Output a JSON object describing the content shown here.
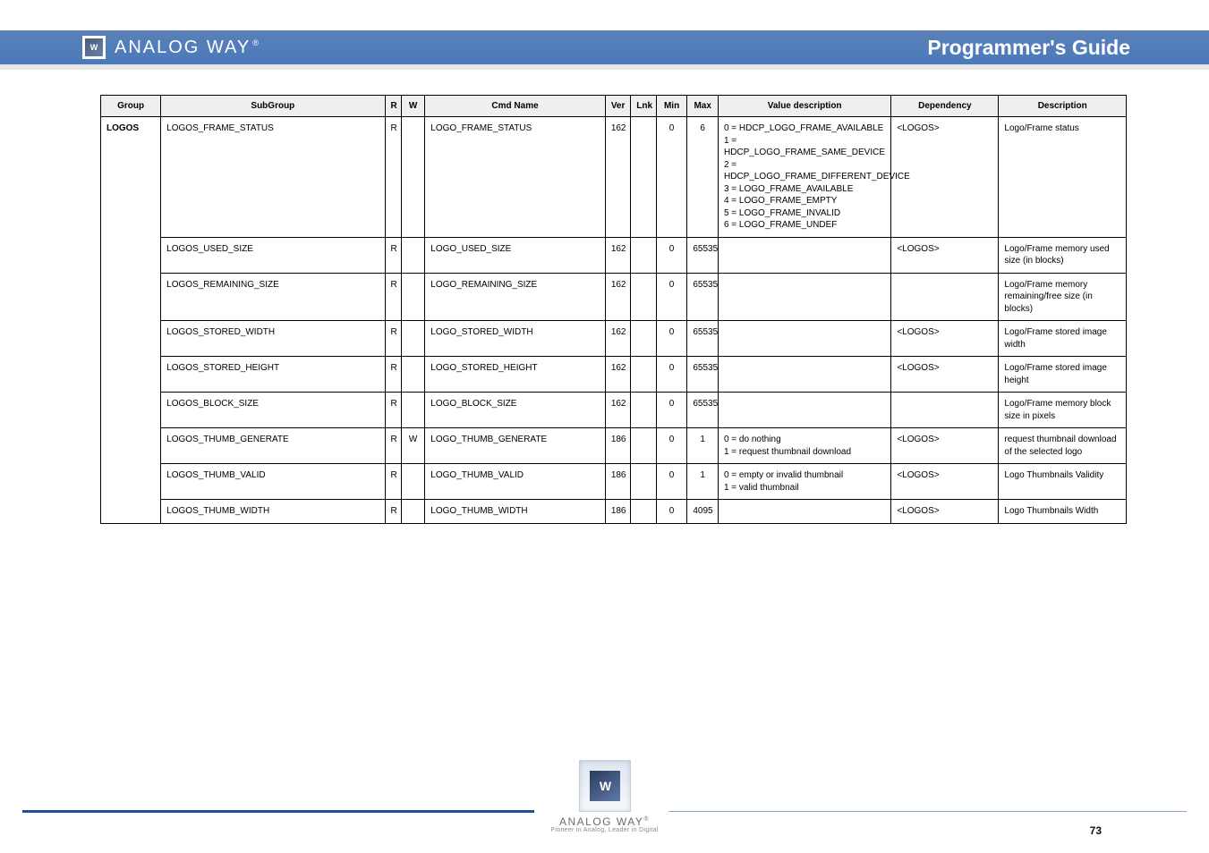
{
  "header": {
    "brand": "ANALOG WAY",
    "reg": "®",
    "title": "Programmer's Guide"
  },
  "table": {
    "headers": {
      "group": "Group",
      "sub": "SubGroup",
      "r": "R",
      "w": "W",
      "cmd": "Cmd Name",
      "ver": "Ver",
      "lnk": "Lnk",
      "min": "Min",
      "max": "Max",
      "val": "Value description",
      "dep": "Dependency",
      "desc": "Description"
    },
    "group_label": "LOGOS",
    "rows": [
      {
        "sub": "LOGOS_FRAME_STATUS",
        "r": "R",
        "w": "",
        "cmd": "LOGO_FRAME_STATUS",
        "ver": "162",
        "lnk": "",
        "min": "0",
        "max": "6",
        "val": "0 = HDCP_LOGO_FRAME_AVAILABLE\n1 = HDCP_LOGO_FRAME_SAME_DEVICE\n2 = HDCP_LOGO_FRAME_DIFFERENT_DEVICE\n3 = LOGO_FRAME_AVAILABLE\n4 = LOGO_FRAME_EMPTY\n5 = LOGO_FRAME_INVALID\n6 = LOGO_FRAME_UNDEF",
        "dep": "<LOGOS>",
        "desc": "Logo/Frame status"
      },
      {
        "sub": "LOGOS_USED_SIZE",
        "r": "R",
        "w": "",
        "cmd": "LOGO_USED_SIZE",
        "ver": "162",
        "lnk": "",
        "min": "0",
        "max": "65535",
        "val": "",
        "dep": "<LOGOS>",
        "desc": "Logo/Frame memory used size (in blocks)"
      },
      {
        "sub": "LOGOS_REMAINING_SIZE",
        "r": "R",
        "w": "",
        "cmd": "LOGO_REMAINING_SIZE",
        "ver": "162",
        "lnk": "",
        "min": "0",
        "max": "65535",
        "val": "",
        "dep": "",
        "desc": "Logo/Frame memory remaining/free size (in blocks)"
      },
      {
        "sub": "LOGOS_STORED_WIDTH",
        "r": "R",
        "w": "",
        "cmd": "LOGO_STORED_WIDTH",
        "ver": "162",
        "lnk": "",
        "min": "0",
        "max": "65535",
        "val": "",
        "dep": "<LOGOS>",
        "desc": "Logo/Frame stored image width"
      },
      {
        "sub": "LOGOS_STORED_HEIGHT",
        "r": "R",
        "w": "",
        "cmd": "LOGO_STORED_HEIGHT",
        "ver": "162",
        "lnk": "",
        "min": "0",
        "max": "65535",
        "val": "",
        "dep": "<LOGOS>",
        "desc": "Logo/Frame stored image height"
      },
      {
        "sub": "LOGOS_BLOCK_SIZE",
        "r": "R",
        "w": "",
        "cmd": "LOGO_BLOCK_SIZE",
        "ver": "162",
        "lnk": "",
        "min": "0",
        "max": "65535",
        "val": "",
        "dep": "",
        "desc": "Logo/Frame memory block size in pixels"
      },
      {
        "sub": "LOGOS_THUMB_GENERATE",
        "r": "R",
        "w": "W",
        "cmd": "LOGO_THUMB_GENERATE",
        "ver": "186",
        "lnk": "",
        "min": "0",
        "max": "1",
        "val": "0 = do nothing\n1 = request thumbnail download",
        "dep": "<LOGOS>",
        "desc": "request thumbnail download of the selected logo"
      },
      {
        "sub": "LOGOS_THUMB_VALID",
        "r": "R",
        "w": "",
        "cmd": "LOGO_THUMB_VALID",
        "ver": "186",
        "lnk": "",
        "min": "0",
        "max": "1",
        "val": "0 = empty or invalid thumbnail\n1 = valid thumbnail",
        "dep": "<LOGOS>",
        "desc": "Logo Thumbnails Validity"
      },
      {
        "sub": "LOGOS_THUMB_WIDTH",
        "r": "R",
        "w": "",
        "cmd": "LOGO_THUMB_WIDTH",
        "ver": "186",
        "lnk": "",
        "min": "0",
        "max": "4095",
        "val": "",
        "dep": "<LOGOS>",
        "desc": "Logo Thumbnails Width"
      }
    ]
  },
  "footer": {
    "brand": "ANALOG WAY",
    "tagline": "Pioneer in Analog, Leader in Digital",
    "page": "73"
  }
}
